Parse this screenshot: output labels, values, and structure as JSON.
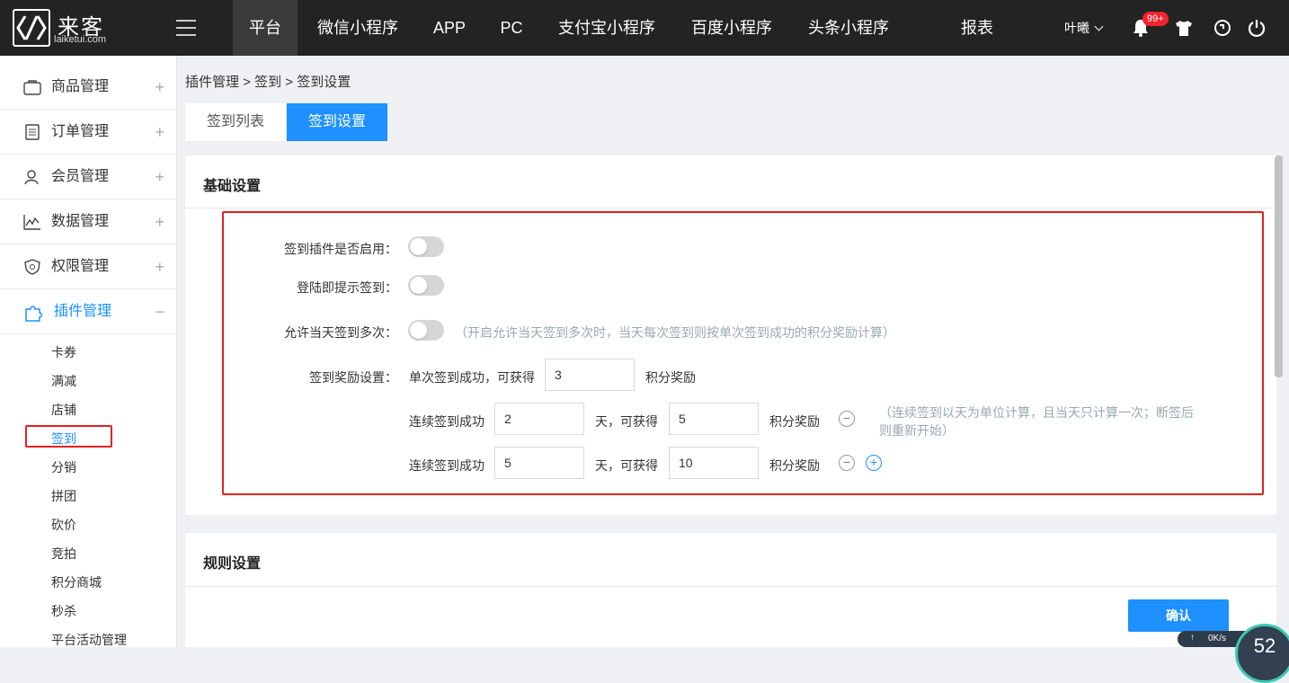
{
  "logo": {
    "cn": "来客",
    "en": "laiketui.com"
  },
  "topnav": {
    "items": [
      "平台",
      "微信小程序",
      "APP",
      "PC",
      "支付宝小程序",
      "百度小程序",
      "头条小程序",
      "报表"
    ],
    "user": "叶曦",
    "badge": "99+"
  },
  "sidebar": {
    "menus": [
      "商品管理",
      "订单管理",
      "会员管理",
      "数据管理",
      "权限管理",
      "插件管理"
    ],
    "plus": "+",
    "minus": "−",
    "subitems": [
      "卡券",
      "满减",
      "店铺",
      "签到",
      "分销",
      "拼团",
      "砍价",
      "竞拍",
      "积分商城",
      "秒杀",
      "平台活动管理"
    ]
  },
  "breadcrumb": "插件管理 > 签到 > 签到设置",
  "tabs": [
    "签到列表",
    "签到设置"
  ],
  "basic": {
    "title": "基础设置",
    "enable_label": "签到插件是否启用：",
    "login_prompt_label": "登陆即提示签到：",
    "multi_label": "允许当天签到多次：",
    "multi_hint": "（开启允许当天签到多次时，当天每次签到则按单次签到成功的积分奖励计算）",
    "reward_label": "签到奖励设置：",
    "single_text": "单次签到成功，可获得",
    "single_value": "3",
    "points_text": "积分奖励",
    "consecutive_text": "连续签到成功",
    "day_get_text": "天，可获得",
    "row1": {
      "days": "2",
      "points": "5"
    },
    "row2": {
      "days": "5",
      "points": "10"
    },
    "consec_hint_1": "（连续签到以天为单位计算，且当天只计算一次；断签后",
    "consec_hint_2": "则重新开始）",
    "minus_symbol": "−",
    "plus_symbol": "+"
  },
  "rules": {
    "title": "规则设置"
  },
  "confirm_label": "确认",
  "net": {
    "speed": "0K/s",
    "dial": "52"
  },
  "colors": {
    "accent": "#1e90ff",
    "highlight": "#e5201f",
    "topbar": "#232323"
  }
}
